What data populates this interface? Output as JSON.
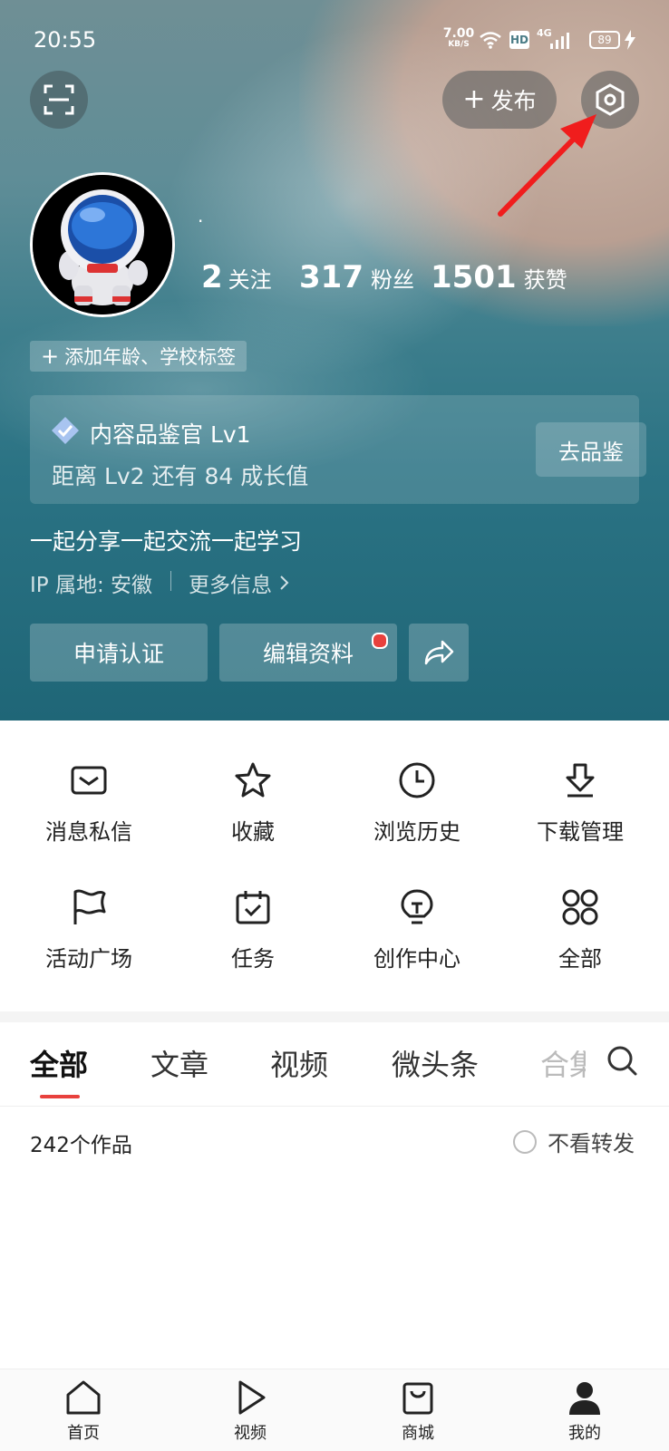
{
  "status_bar": {
    "time": "20:55",
    "net_speed_value": "7.00",
    "net_speed_unit": "KB/S",
    "hd": "HD",
    "signal_label": "4G",
    "battery": "89"
  },
  "header": {
    "publish_label": "发布"
  },
  "profile": {
    "username": "·",
    "stats": [
      {
        "value": "2",
        "label": "关注"
      },
      {
        "value": "317",
        "label": "粉丝"
      },
      {
        "value": "1501",
        "label": "获赞"
      }
    ],
    "add_tag_label": "添加年龄、学校标签",
    "badge_title": "内容品鉴官 Lv1",
    "badge_progress": "距离 Lv2 还有 84 成长值",
    "badge_button": "去品鉴",
    "bio": "一起分享一起交流一起学习",
    "ip_location": "IP 属地: 安徽",
    "more_info": "更多信息",
    "apply_verify": "申请认证",
    "edit_profile": "编辑资料"
  },
  "grid": {
    "items": [
      {
        "label": "消息私信",
        "icon": "mail-icon"
      },
      {
        "label": "收藏",
        "icon": "star-icon"
      },
      {
        "label": "浏览历史",
        "icon": "clock-icon"
      },
      {
        "label": "下载管理",
        "icon": "download-icon"
      },
      {
        "label": "活动广场",
        "icon": "flag-icon"
      },
      {
        "label": "任务",
        "icon": "calendar-check-icon"
      },
      {
        "label": "创作中心",
        "icon": "lightbulb-icon"
      },
      {
        "label": "全部",
        "icon": "grid-dots-icon"
      }
    ]
  },
  "tabs": {
    "items": [
      "全部",
      "文章",
      "视频",
      "微头条",
      "合集"
    ],
    "active": 0
  },
  "works": {
    "count_label": "242个作品",
    "hide_reposts": "不看转发"
  },
  "bottom_nav": {
    "items": [
      "首页",
      "视频",
      "商城",
      "我的"
    ]
  },
  "colors": {
    "accent_red": "#e8413d",
    "hero_teal": "#2b7384"
  }
}
